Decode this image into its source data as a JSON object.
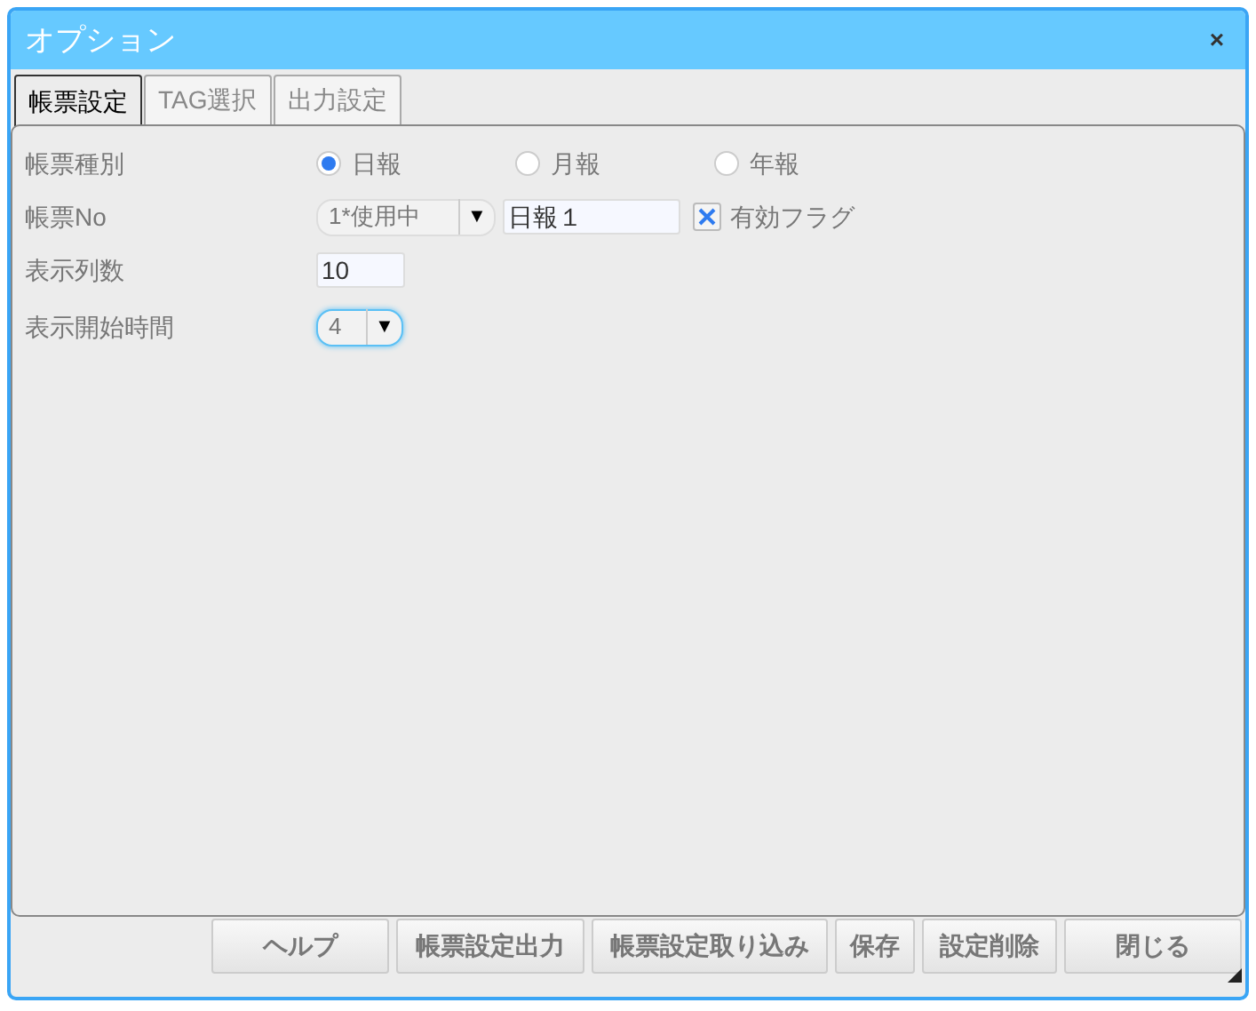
{
  "window": {
    "title": "オプション",
    "close": "×"
  },
  "tabs": [
    {
      "label": "帳票設定",
      "selected": true
    },
    {
      "label": "TAG選択",
      "selected": false
    },
    {
      "label": "出力設定",
      "selected": false
    }
  ],
  "report_type": {
    "label": "帳票種別",
    "options": [
      {
        "label": "日報",
        "selected": true
      },
      {
        "label": "月報",
        "selected": false
      },
      {
        "label": "年報",
        "selected": false
      }
    ]
  },
  "report_no": {
    "label": "帳票No",
    "select": {
      "value": "1*使用中",
      "arrow": "▼",
      "focused": false
    },
    "name_value": "日報１",
    "valid_flag": {
      "label": "有効フラグ",
      "checked": true
    }
  },
  "columns": {
    "label": "表示列数",
    "value": "10"
  },
  "start_hour": {
    "label": "表示開始時間",
    "select": {
      "value": "4",
      "arrow": "▼",
      "focused": true
    }
  },
  "buttons": [
    "ヘルプ",
    "帳票設定出力",
    "帳票設定取り込み",
    "保存",
    "設定削除",
    "閉じる"
  ]
}
